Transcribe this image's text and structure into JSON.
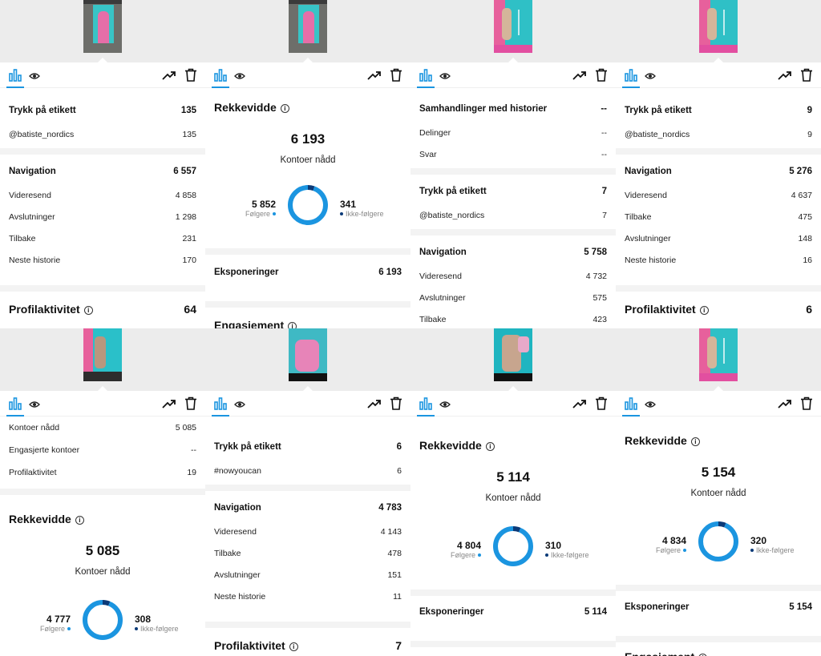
{
  "colors": {
    "accent": "#1b95e0",
    "dark_segment": "#0b3a78",
    "separator": "#f3f3f3"
  },
  "icons": [
    "bar-chart-icon",
    "eye-icon",
    "trend-arrow-icon",
    "trash-icon",
    "info-icon"
  ],
  "panels": [
    {
      "rows": [
        {
          "label": "Trykk på etikett",
          "value": "135",
          "kind": "head"
        },
        {
          "label": "@batiste_nordics",
          "value": "135"
        },
        {
          "label": "Navigation",
          "value": "6 557",
          "kind": "head"
        },
        {
          "label": "Videresend",
          "value": "4 858"
        },
        {
          "label": "Avslutninger",
          "value": "1 298"
        },
        {
          "label": "Tilbake",
          "value": "231"
        },
        {
          "label": "Neste historie",
          "value": "170"
        },
        {
          "label": "Profilaktivitet",
          "value": "64",
          "kind": "big"
        }
      ]
    },
    {
      "reach": {
        "title": "Rekkevidde",
        "value": "6 193",
        "caption": "Kontoer nådd",
        "followers": "5 852",
        "followers_label": "Følgere",
        "nonfollowers": "341",
        "nonfollowers_label": "Ikke-følgere",
        "followers_fraction": 0.945
      },
      "rows": [
        {
          "label": "Eksponeringer",
          "value": "6 193",
          "kind": "head"
        },
        {
          "label": "Engasjement",
          "value": "",
          "kind": "big"
        }
      ]
    },
    {
      "rows": [
        {
          "label": "Samhandlinger med historier",
          "value": "--",
          "kind": "head"
        },
        {
          "label": "Delinger",
          "value": "--"
        },
        {
          "label": "Svar",
          "value": "--"
        },
        {
          "label": "Trykk på etikett",
          "value": "7",
          "kind": "head"
        },
        {
          "label": "@batiste_nordics",
          "value": "7"
        },
        {
          "label": "Navigation",
          "value": "5 758",
          "kind": "head"
        },
        {
          "label": "Videresend",
          "value": "4 732"
        },
        {
          "label": "Avslutninger",
          "value": "575"
        },
        {
          "label": "Tilbake",
          "value": "423"
        }
      ]
    },
    {
      "rows": [
        {
          "label": "Trykk på etikett",
          "value": "9",
          "kind": "head"
        },
        {
          "label": "@batiste_nordics",
          "value": "9"
        },
        {
          "label": "Navigation",
          "value": "5 276",
          "kind": "head"
        },
        {
          "label": "Videresend",
          "value": "4 637"
        },
        {
          "label": "Tilbake",
          "value": "475"
        },
        {
          "label": "Avslutninger",
          "value": "148"
        },
        {
          "label": "Neste historie",
          "value": "16"
        },
        {
          "label": "Profilaktivitet",
          "value": "6",
          "kind": "big"
        }
      ]
    },
    {
      "rows": [
        {
          "label": "Kontoer nådd",
          "value": "5 085"
        },
        {
          "label": "Engasjerte kontoer",
          "value": "--"
        },
        {
          "label": "Profilaktivitet",
          "value": "19"
        }
      ],
      "reach": {
        "title": "Rekkevidde",
        "value": "5 085",
        "caption": "Kontoer nådd",
        "followers": "4 777",
        "followers_label": "Følgere",
        "nonfollowers": "308",
        "nonfollowers_label": "Ikke-følgere",
        "followers_fraction": 0.939
      }
    },
    {
      "rows": [
        {
          "label": "Trykk på etikett",
          "value": "6",
          "kind": "head"
        },
        {
          "label": "#nowyoucan",
          "value": "6"
        },
        {
          "label": "Navigation",
          "value": "4 783",
          "kind": "head"
        },
        {
          "label": "Videresend",
          "value": "4 143"
        },
        {
          "label": "Tilbake",
          "value": "478"
        },
        {
          "label": "Avslutninger",
          "value": "151"
        },
        {
          "label": "Neste historie",
          "value": "11"
        },
        {
          "label": "Profilaktivitet",
          "value": "7",
          "kind": "big"
        }
      ]
    },
    {
      "reach": {
        "title": "Rekkevidde",
        "value": "5 114",
        "caption": "Kontoer nådd",
        "followers": "4 804",
        "followers_label": "Følgere",
        "nonfollowers": "310",
        "nonfollowers_label": "Ikke-følgere",
        "followers_fraction": 0.939
      },
      "rows": [
        {
          "label": "Eksponeringer",
          "value": "5 114",
          "kind": "head"
        },
        {
          "label": "Engasjement",
          "value": "",
          "kind": "big"
        }
      ]
    },
    {
      "reach": {
        "title": "Rekkevidde",
        "value": "5 154",
        "caption": "Kontoer nådd",
        "followers": "4 834",
        "followers_label": "Følgere",
        "nonfollowers": "320",
        "nonfollowers_label": "Ikke-følgere",
        "followers_fraction": 0.938
      },
      "rows": [
        {
          "label": "Eksponeringer",
          "value": "5 154",
          "kind": "head"
        },
        {
          "label": "Engasjement",
          "value": "",
          "kind": "big"
        }
      ]
    }
  ]
}
